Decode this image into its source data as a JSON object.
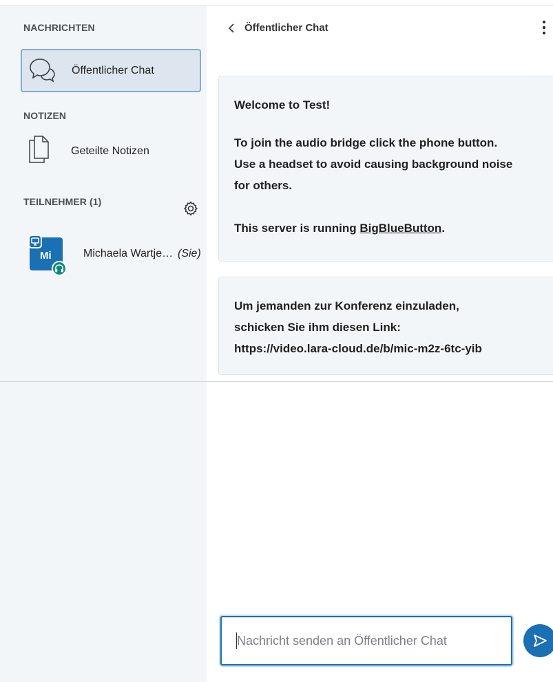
{
  "sidebar": {
    "messages_title": "NACHRICHTEN",
    "public_chat_label": "Öffentlicher Chat",
    "notes_title": "NOTIZEN",
    "shared_notes_label": "Geteilte Notizen",
    "participants_title": "TEILNEHMER (1)",
    "users": [
      {
        "initials": "Mi",
        "name": "Michaela Wartje…",
        "you_label": "(Sie)"
      }
    ]
  },
  "chat": {
    "header_title": "Öffentlicher Chat",
    "messages": {
      "welcome_title": "Welcome to Test!",
      "welcome_line1": "To join the audio bridge click the phone button.",
      "welcome_line2": "Use a headset to avoid causing background noise",
      "welcome_line3": "for others.",
      "server_prefix": "This server is running",
      "server_link": "BigBlueButton",
      "server_suffix": ".",
      "invite_line1": "Um jemanden zur Konferenz einzuladen,",
      "invite_line2": "schicken Sie ihm diesen Link:",
      "invite_line3": "https://video.lara-cloud.de/b/mic-m2z-6tc-yib"
    },
    "input_placeholder": "Nachricht senden an Öffentlicher Chat",
    "input_value": ""
  },
  "colors": {
    "sidebar_bg": "#f3f6f9",
    "accent": "#1b6fb3",
    "selected_bg": "#dde6ee",
    "audio_badge": "#0f8a7e"
  },
  "icons": {
    "public_chat": "chat-bubbles-icon",
    "shared_notes": "document-copy-icon",
    "settings": "gear-icon",
    "back": "chevron-left-icon",
    "more": "kebab-menu-icon",
    "send": "send-arrow-icon",
    "presenter": "presenter-monitor-icon",
    "audio": "headphones-icon"
  }
}
